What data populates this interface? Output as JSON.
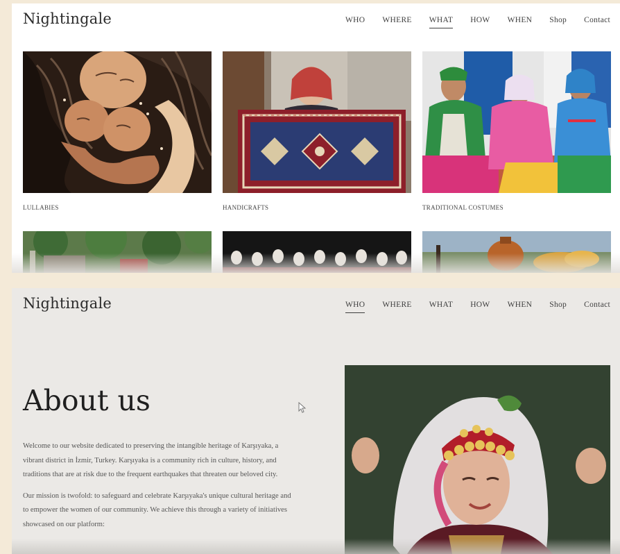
{
  "brand": "Nightingale",
  "nav": {
    "items": [
      "WHO",
      "WHERE",
      "WHAT",
      "HOW",
      "WHEN",
      "Shop",
      "Contact"
    ]
  },
  "page_what": {
    "active_nav": "WHAT",
    "cards": [
      {
        "caption": "LULLABIES",
        "image_icon": "mother-children-painting"
      },
      {
        "caption": "HANDICRAFTS",
        "image_icon": "woman-holding-rug-photo"
      },
      {
        "caption": "TRADITIONAL COSTUMES",
        "image_icon": "women-in-costumes-photo"
      }
    ]
  },
  "page_about": {
    "active_nav": "WHO",
    "title": "About us",
    "paragraphs": [
      "Welcome to our website dedicated to preserving the intangible heritage of Karşıyaka, a vibrant district in İzmir, Turkey. Karşıyaka is a community rich in culture, history, and traditions that are at risk due to the frequent earthquakes that threaten our beloved city.",
      "Our mission is twofold: to safeguard and celebrate Karşıyaka's unique cultural heritage and to empower the women of our community. We achieve this through a variety of initiatives showcased on our platform:"
    ],
    "image_icon": "dancer-in-traditional-headdress-photo"
  },
  "colors": {
    "frame": "#f4ead8",
    "page_top": "#ffffff",
    "page_bottom": "#ebe9e6",
    "text": "#2b2b2b"
  }
}
